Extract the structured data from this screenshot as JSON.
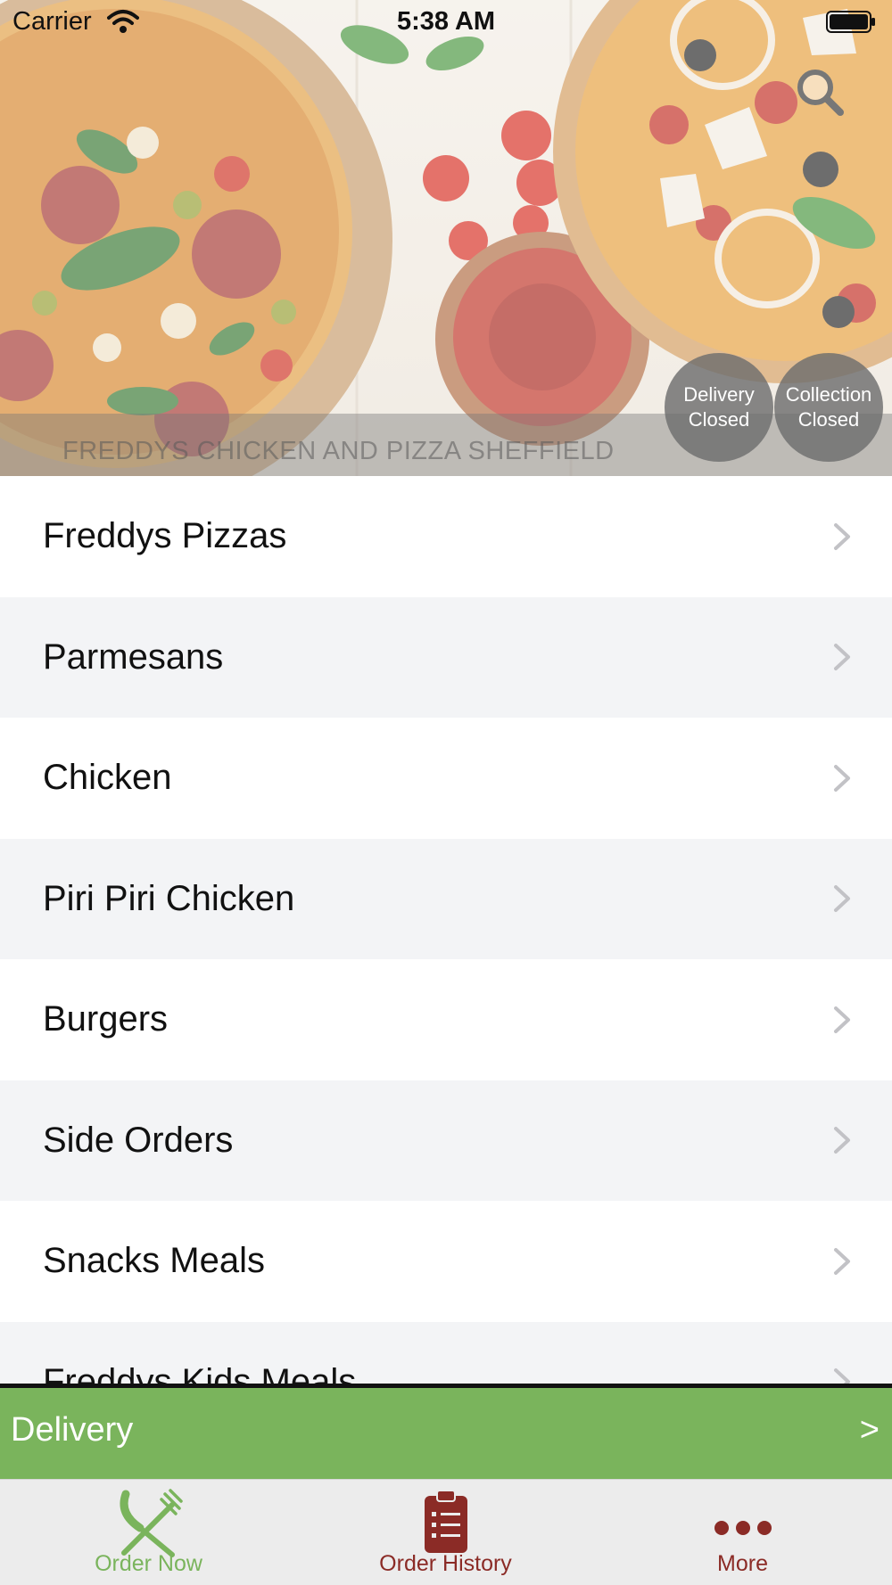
{
  "status_bar": {
    "carrier": "Carrier",
    "time": "5:38 AM",
    "icons": [
      "wifi-icon",
      "battery-icon"
    ]
  },
  "hero": {
    "restaurant_name": "FREDDYS CHICKEN AND PIZZA SHEFFIELD",
    "search_icon": "search-icon",
    "badges": {
      "delivery": {
        "line1": "Delivery",
        "line2": "Closed"
      },
      "collection": {
        "line1": "Collection",
        "line2": "Closed"
      }
    }
  },
  "menu": {
    "items": [
      {
        "label": "Freddys Pizzas"
      },
      {
        "label": "Parmesans"
      },
      {
        "label": "Chicken"
      },
      {
        "label": "Piri Piri Chicken"
      },
      {
        "label": "Burgers"
      },
      {
        "label": "Side Orders"
      },
      {
        "label": "Snacks Meals"
      },
      {
        "label": "Freddys Kids Meals"
      }
    ]
  },
  "delivery_bar": {
    "label": "Delivery",
    "arrow": ">"
  },
  "tab_bar": {
    "tabs": [
      {
        "label": "Order Now",
        "icon": "fork-knife-icon"
      },
      {
        "label": "Order History",
        "icon": "clipboard-icon"
      },
      {
        "label": "More",
        "icon": "more-dots-icon"
      }
    ]
  },
  "colors": {
    "accent_green": "#7ab45c",
    "brand_red": "#8b2b26",
    "row_alt": "#f3f4f6",
    "badge_gray": "#6e6e6e"
  }
}
